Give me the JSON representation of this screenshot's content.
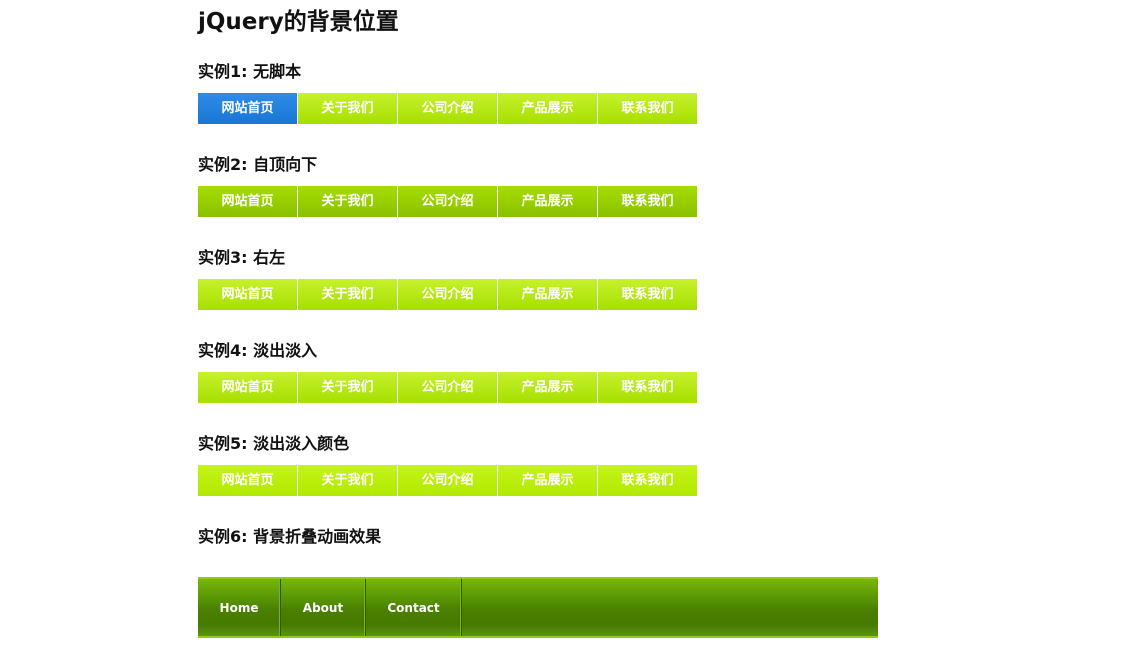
{
  "page": {
    "title": "jQuery的背景位置"
  },
  "menu_labels": [
    "网站首页",
    "关于我们",
    "公司介绍",
    "产品展示",
    "联系我们"
  ],
  "examples": [
    {
      "title": "实例1: 无脚本",
      "active_item": "网站首页"
    },
    {
      "title": "实例2: 自顶向下"
    },
    {
      "title": "实例3: 右左"
    },
    {
      "title": "实例4: 淡出淡入"
    },
    {
      "title": "实例5: 淡出淡入颜色"
    },
    {
      "title": "实例6: 背景折叠动画效果"
    }
  ],
  "bottom_nav": {
    "items": [
      "Home",
      "About",
      "Contact"
    ]
  },
  "colors": {
    "menu_green": "#b3e800",
    "menu_active_blue": "#1f80e0",
    "nav_dark_green": "#4a7f02",
    "nav_border_green": "#93c91b"
  }
}
